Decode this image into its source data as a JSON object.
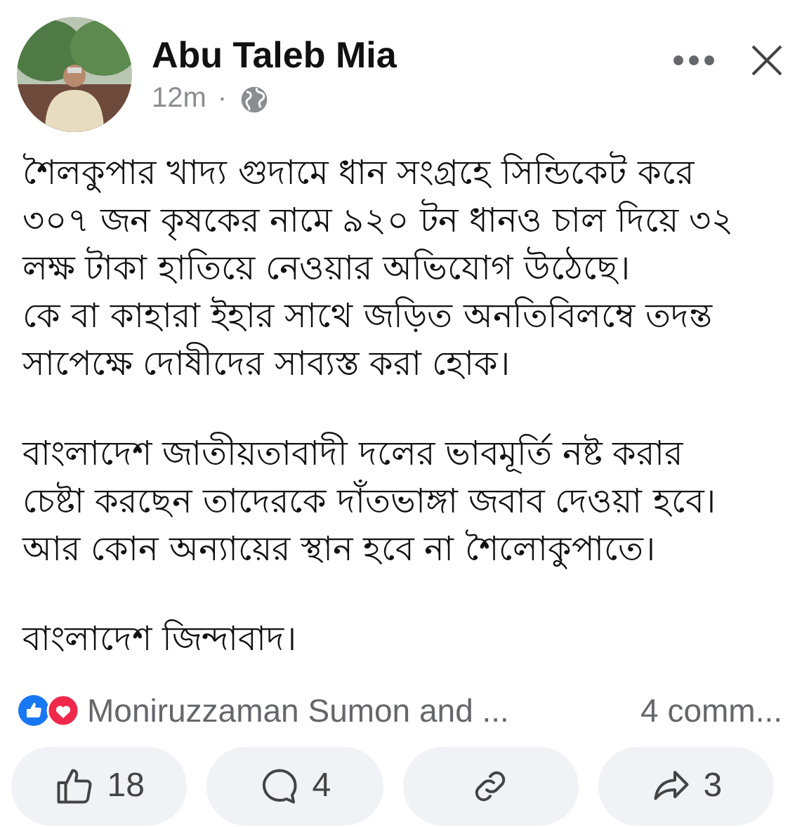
{
  "post": {
    "author": "Abu Taleb Mia",
    "time": "12m",
    "separator": "·",
    "paragraphs": [
      [
        "শৈলকুপার খাদ্য গুদামে ধান সংগ্রহে সিন্ডিকেট করে",
        "৩০৭ জন কৃষকের নামে ৯২০ টন ধানও চাল দিয়ে ৩২",
        "লক্ষ টাকা হাতিয়ে নেওয়ার অভিযোগ উঠেছে।",
        "কে বা কাহারা ইহার সাথে জড়িত অনতিবিলম্বে তদন্ত",
        "সাপেক্ষে দোষীদের সাব্যস্ত করা হোক।"
      ],
      [
        "বাংলাদেশ জাতীয়তাবাদী দলের ভাবমূর্তি নষ্ট করার",
        "চেষ্টা করছেন তাদেরকে দাঁতভাঙ্গা জবাব দেওয়া হবে।",
        "আর কোন অন্যায়ের স্থান হবে না শৈলোকুপাতে।"
      ],
      [
        "বাংলাদেশ জিন্দাবাদ।"
      ]
    ],
    "reactions_text": "Moniruzzaman Sumon and ...",
    "comments_text": "4 comm...",
    "actions": [
      {
        "kind": "like",
        "count": "18"
      },
      {
        "kind": "comment",
        "count": "4"
      },
      {
        "kind": "link"
      },
      {
        "kind": "share",
        "count": "3"
      }
    ]
  }
}
